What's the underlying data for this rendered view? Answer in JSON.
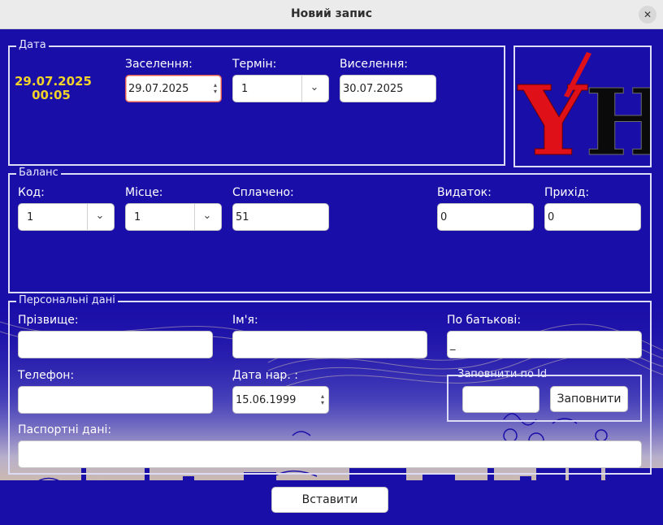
{
  "window": {
    "title": "Новий запис",
    "close_symbol": "✕"
  },
  "date_group": {
    "legend": "Дата",
    "current_date": "29.07.2025",
    "current_time": "00:05",
    "checkin_label": "Заселення:",
    "checkin_value": "29.07.2025",
    "term_label": "Термін:",
    "term_value": "1",
    "checkout_label": "Виселення:",
    "checkout_value": "30.07.2025"
  },
  "logo": {
    "letters": "YH",
    "colors": {
      "y": "#e01018",
      "h": "#0a0a0a"
    }
  },
  "balance_group": {
    "legend": "Баланс",
    "code_label": "Код:",
    "code_value": "1",
    "place_label": "Місце:",
    "place_value": "1",
    "paid_label": "Сплачено:",
    "paid_value": "51",
    "expense_label": "Видаток:",
    "expense_value": "0",
    "income_label": "Прихід:",
    "income_value": "0"
  },
  "personal_group": {
    "legend": "Персональні дані",
    "surname_label": "Прізвище:",
    "surname_value": "",
    "name_label": "Ім'я:",
    "name_value": "",
    "patronymic_label": "По батькові:",
    "patronymic_value": "_",
    "phone_label": "Телефон:",
    "phone_value": "",
    "birthdate_label": "Дата нар. :",
    "birthdate_value": "15.06.1999",
    "passport_label": "Паспортні дані:",
    "passport_value": "",
    "fill_by_id": {
      "legend": "Заповнити по Id",
      "id_value": "",
      "button_label": "Заповнити"
    }
  },
  "insert_button_label": "Вставити",
  "colors": {
    "background": "#1a0ea8",
    "accent_date": "#f0d22b",
    "titlebar": "#ebebeb"
  },
  "icons": {
    "combo_arrow": "chevron-down-icon",
    "spin": "spin-icon"
  }
}
